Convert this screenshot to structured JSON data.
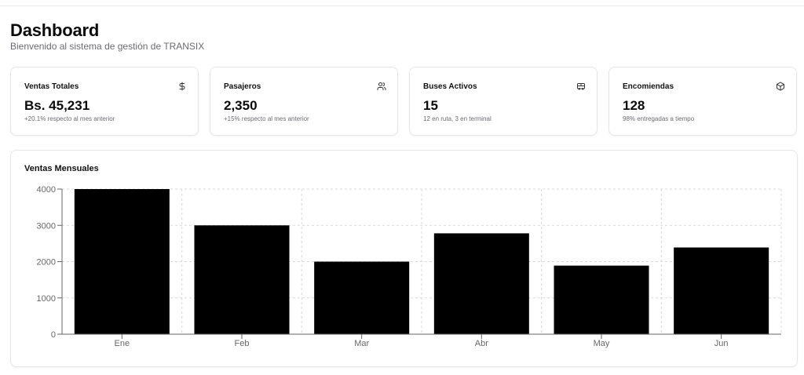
{
  "header": {
    "title": "Dashboard",
    "subtitle": "Bienvenido al sistema de gestión de TRANSIX"
  },
  "stats": [
    {
      "title": "Ventas Totales",
      "icon": "dollar-icon",
      "value": "Bs. 45,231",
      "note": "+20.1% respecto al mes anterior"
    },
    {
      "title": "Pasajeros",
      "icon": "users-icon",
      "value": "2,350",
      "note": "+15% respecto al mes anterior"
    },
    {
      "title": "Buses Activos",
      "icon": "bus-icon",
      "value": "15",
      "note": "12 en ruta, 3 en terminal"
    },
    {
      "title": "Encomiendas",
      "icon": "package-icon",
      "value": "128",
      "note": "98% entregadas a tiempo"
    }
  ],
  "chart_card": {
    "title": "Ventas Mensuales"
  },
  "chart_data": {
    "type": "bar",
    "title": "Ventas Mensuales",
    "categories": [
      "Ene",
      "Feb",
      "Mar",
      "Abr",
      "May",
      "Jun"
    ],
    "values": [
      4000,
      3000,
      2000,
      2780,
      1890,
      2390
    ],
    "ylim": [
      0,
      4000
    ],
    "yticks": [
      0,
      1000,
      2000,
      3000,
      4000
    ],
    "grid": true,
    "bar_color": "#000000",
    "grid_color": "#d9d9dd"
  }
}
